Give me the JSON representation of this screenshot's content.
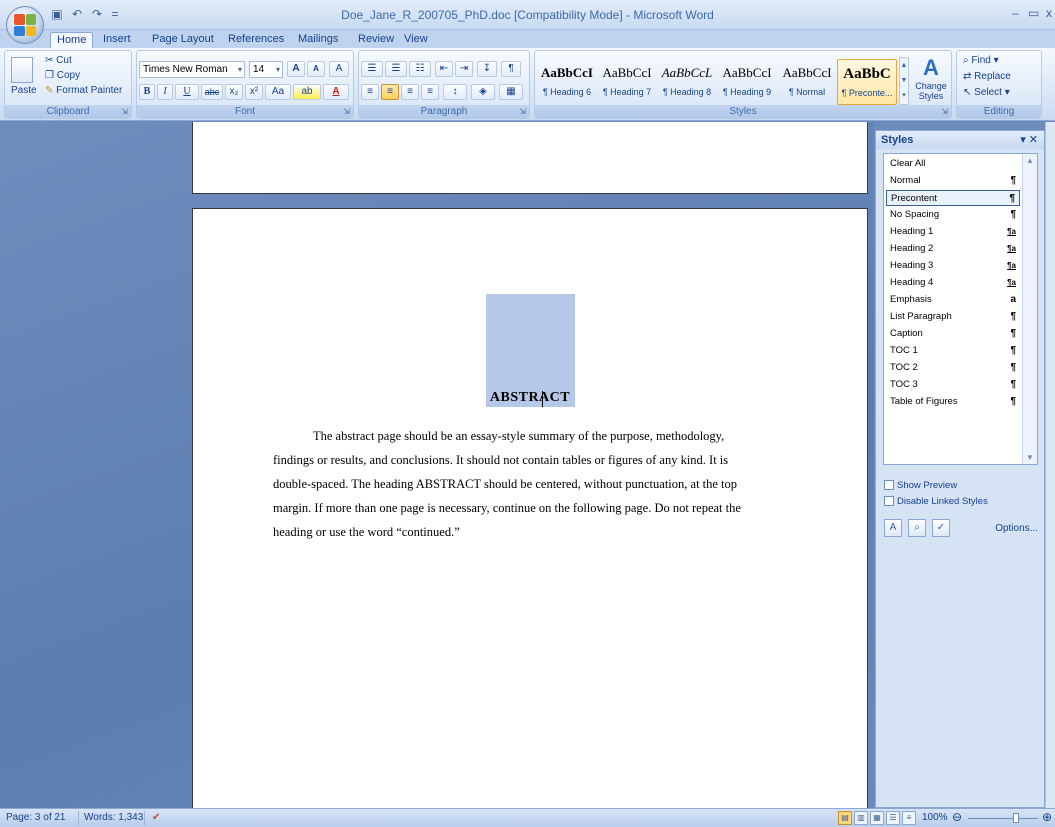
{
  "window": {
    "title": "Doe_Jane_R_200705_PhD.doc [Compatibility Mode] - Microsoft Word",
    "minimize": "–",
    "restore": "▭",
    "close": "x"
  },
  "quick_access": {
    "save_icon": "save-icon",
    "undo_icon": "undo-icon",
    "redo_icon": "redo-icon",
    "customize": "="
  },
  "tabs": [
    "Home",
    "Insert",
    "Page Layout",
    "References",
    "Mailings",
    "Review",
    "View"
  ],
  "ribbon": {
    "clipboard": {
      "label": "Clipboard",
      "paste": "Paste",
      "cut": "Cut",
      "copy": "Copy",
      "format_painter": "Format Painter"
    },
    "font": {
      "label": "Font",
      "font_name": "Times New Roman",
      "font_size": "14",
      "grow": "A",
      "shrink": "A",
      "clear": "A",
      "bold": "B",
      "italic": "I",
      "underline": "U",
      "strike": "abc",
      "subscript": "x₂",
      "superscript": "x²",
      "case": "Aa",
      "highlight": "ab",
      "color": "A"
    },
    "paragraph": {
      "label": "Paragraph"
    },
    "styles": {
      "label": "Styles",
      "tiles": [
        {
          "sample": "AaBbCcI",
          "name": "¶ Heading 6"
        },
        {
          "sample": "AaBbCcI",
          "name": "¶ Heading 7"
        },
        {
          "sample": "AaBbCcL",
          "name": "¶ Heading 8"
        },
        {
          "sample": "AaBbCcI",
          "name": "¶ Heading 9"
        },
        {
          "sample": "AaBbCcI",
          "name": "¶ Normal"
        },
        {
          "sample": "AaBbC",
          "name": "¶ Preconte..."
        }
      ],
      "change_styles": "Change Styles"
    },
    "editing": {
      "label": "Editing",
      "find": "Find",
      "replace": "Replace",
      "select": "Select"
    }
  },
  "document": {
    "heading": "ABSTRACT",
    "body_lines": [
      "The abstract page should be an essay-style summary of the purpose, methodology,",
      "findings or results, and conclusions.  It should not contain tables or figures of any kind.  It is",
      "double-spaced.  The heading ABSTRACT should be centered, without punctuation, at the top",
      "margin.  If more than one page is necessary, continue on the following page.  Do not repeat the",
      "heading or use the word “continued.”"
    ]
  },
  "styles_pane": {
    "title": "Styles",
    "items": [
      {
        "name": "Clear All",
        "mark": ""
      },
      {
        "name": "Normal",
        "mark": "¶"
      },
      {
        "name": "Precontent",
        "mark": "¶"
      },
      {
        "name": "No Spacing",
        "mark": "¶"
      },
      {
        "name": "Heading 1",
        "mark": "¶a"
      },
      {
        "name": "Heading 2",
        "mark": "¶a"
      },
      {
        "name": "Heading 3",
        "mark": "¶a"
      },
      {
        "name": "Heading 4",
        "mark": "¶a"
      },
      {
        "name": "Emphasis",
        "mark": "a"
      },
      {
        "name": "List Paragraph",
        "mark": "¶"
      },
      {
        "name": "Caption",
        "mark": "¶"
      },
      {
        "name": "TOC 1",
        "mark": "¶"
      },
      {
        "name": "TOC 2",
        "mark": "¶"
      },
      {
        "name": "TOC 3",
        "mark": "¶"
      },
      {
        "name": "Table of Figures",
        "mark": "¶"
      }
    ],
    "selected": "Precontent",
    "show_preview": "Show Preview",
    "disable_linked": "Disable Linked Styles",
    "options": "Options..."
  },
  "statusbar": {
    "page": "Page: 3 of 21",
    "words": "Words: 1,343",
    "zoom": "100%"
  },
  "colors": {
    "accent": "#15428b",
    "ribbon": "#dbe7f6",
    "selection": "#b6c8e8"
  }
}
